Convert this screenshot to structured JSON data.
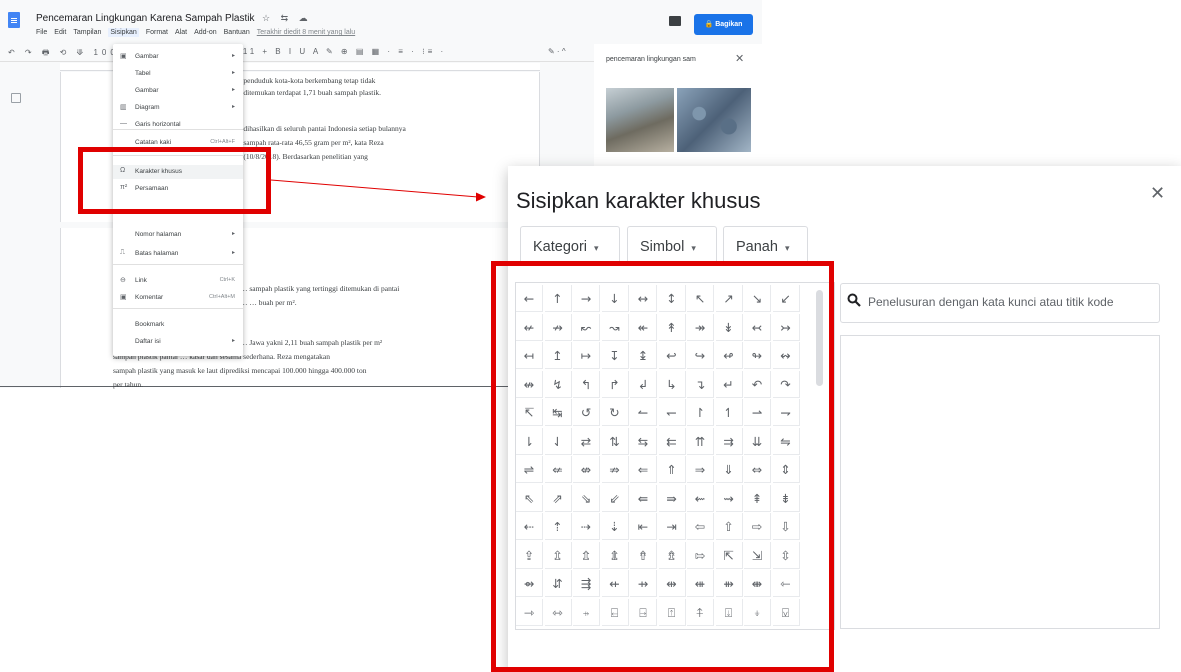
{
  "docs": {
    "title": "Pencemaran Lingkungan Karena Sampah Plastik",
    "title_icons": "☆ ⇆ ☁",
    "menubar": [
      "File",
      "Edit",
      "Tampilan",
      "Sisipkan",
      "Format",
      "Alat",
      "Add-on",
      "Bantuan",
      "Terakhir diedit 8 menit yang lalu"
    ],
    "active_menu_index": 3,
    "share_label": "🔒 Bagikan",
    "toolbar_left": "↶ ↷ 🖶 ⟲ ⟱ 100%",
    "toolbar_right": "- 11 + B I U A ✎ ⊕ ▤ ▦ · ≡ · ⁝≡ ·",
    "toolbar_pencil": "✎ · ^",
    "page1_lines": [
      "… penduduk kota-kota berkembang tetap tidak",
      "… ditemukan terdapat 1,71 buah sampah plastik.",
      "",
      "… dihasilkan di seluruh pantai Indonesia setiap bulannya",
      "… sampah rata-rata 46,55 gram per m², kata Reza",
      "… (10/8/2018). Berdasarkan penelitian yang"
    ],
    "page2_lines": [
      "… sampah plastik yang tertinggi ditemukan di pantai",
      "… … buah per m².",
      "",
      "… Jawa yakni 2,11 buah sampah plastik per m²",
      "sampah plastik pantai … kasar dan sesama sederhana. Reza mengatakan",
      "sampah plastik yang masuk ke laut diprediksi mencapai 100.000 hingga 400.000 ton",
      "per tahun."
    ]
  },
  "insert_menu": [
    {
      "icon": "▣",
      "label": "Gambar",
      "arrow": "▸"
    },
    {
      "icon": "",
      "label": "Tabel",
      "arrow": "▸"
    },
    {
      "icon": "",
      "label": "Gambar",
      "arrow": "▸"
    },
    {
      "icon": "▥",
      "label": "Diagram",
      "arrow": "▸"
    },
    {
      "icon": "—",
      "label": "Garis horizontal",
      "arrow": ""
    },
    {
      "icon": "",
      "label": "Catatan kaki",
      "arrow": "",
      "shortcut": "Ctrl+Alt+F"
    },
    {
      "icon": "Ω",
      "label": "Karakter khusus",
      "arrow": ""
    },
    {
      "icon": "π²",
      "label": "Persamaan",
      "arrow": ""
    },
    {
      "icon": "",
      "label": "Header & footer",
      "arrow": "▸"
    },
    {
      "icon": "",
      "label": "Nomor halaman",
      "arrow": "▸"
    },
    {
      "icon": "⎍",
      "label": "Batas halaman",
      "arrow": "▸"
    },
    {
      "icon": "⊖",
      "label": "Link",
      "arrow": "",
      "shortcut": "Ctrl+K"
    },
    {
      "icon": "▣",
      "label": "Komentar",
      "arrow": "",
      "shortcut": "Ctrl+Alt+M"
    },
    {
      "icon": "",
      "label": "Bookmark",
      "arrow": ""
    },
    {
      "icon": "",
      "label": "Daftar isi",
      "arrow": "▸"
    }
  ],
  "side_panel": {
    "query": "pencemaran lingkungan sam",
    "close": "✕"
  },
  "dialog": {
    "title": "Sisipkan karakter khusus",
    "close": "✕",
    "dropdowns": [
      "Kategori",
      "Simbol",
      "Panah"
    ],
    "dropdown_caret": "▾",
    "search_placeholder": "Penelusuran dengan kata kunci atau titik kode",
    "symbols": [
      [
        "←",
        "↑",
        "→",
        "↓",
        "↔",
        "↕",
        "↖",
        "↗",
        "↘",
        "↙"
      ],
      [
        "↚",
        "↛",
        "↜",
        "↝",
        "↞",
        "↟",
        "↠",
        "↡",
        "↢",
        "↣"
      ],
      [
        "↤",
        "↥",
        "↦",
        "↧",
        "↨",
        "↩",
        "↪",
        "↫",
        "↬",
        "↭"
      ],
      [
        "↮",
        "↯",
        "↰",
        "↱",
        "↲",
        "↳",
        "↴",
        "↵",
        "↶",
        "↷"
      ],
      [
        "↸",
        "↹",
        "↺",
        "↻",
        "↼",
        "↽",
        "↾",
        "↿",
        "⇀",
        "⇁"
      ],
      [
        "⇂",
        "⇃",
        "⇄",
        "⇅",
        "⇆",
        "⇇",
        "⇈",
        "⇉",
        "⇊",
        "⇋"
      ],
      [
        "⇌",
        "⇍",
        "⇎",
        "⇏",
        "⇐",
        "⇑",
        "⇒",
        "⇓",
        "⇔",
        "⇕"
      ],
      [
        "⇖",
        "⇗",
        "⇘",
        "⇙",
        "⇚",
        "⇛",
        "⇜",
        "⇝",
        "⇞",
        "⇟"
      ],
      [
        "⇠",
        "⇡",
        "⇢",
        "⇣",
        "⇤",
        "⇥",
        "⇦",
        "⇧",
        "⇨",
        "⇩"
      ],
      [
        "⇪",
        "⇫",
        "⇬",
        "⇭",
        "⇮",
        "⇯",
        "⇰",
        "⇱",
        "⇲",
        "⇳"
      ],
      [
        "⇴",
        "⇵",
        "⇶",
        "⇷",
        "⇸",
        "⇹",
        "⇺",
        "⇻",
        "⇼",
        "⇽"
      ],
      [
        "⇾",
        "⇿",
        "⍆",
        "⍇",
        "⍈",
        "⍐",
        "⍏",
        "⍗",
        "⍖",
        "⍌"
      ]
    ]
  },
  "colors": {
    "highlight": "#e00000",
    "accent": "#1a73e8"
  }
}
